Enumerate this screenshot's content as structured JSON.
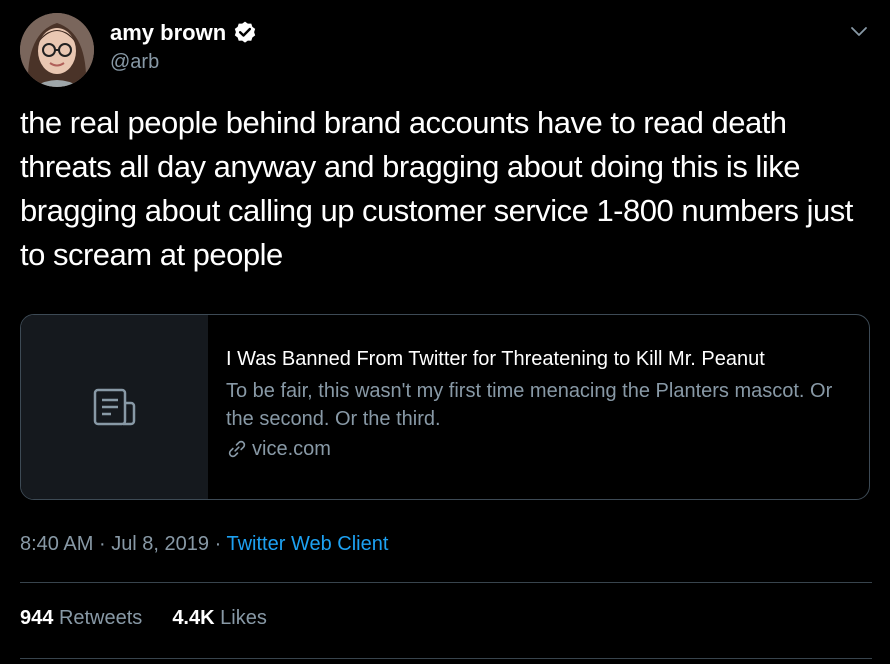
{
  "author": {
    "display_name": "amy brown",
    "handle": "@arb",
    "verified_icon": "verified-badge-icon"
  },
  "tweet": {
    "text": "the real people behind brand accounts have to read death threats all day anyway and bragging about doing this is like bragging about calling up customer service 1-800 numbers just to scream at people"
  },
  "link_card": {
    "title": "I Was Banned From Twitter for Threatening to Kill Mr. Peanut",
    "description": "To be fair, this wasn't my first time menacing the Planters mascot. Or the second. Or the third.",
    "domain": "vice.com",
    "thumbnail_icon": "article-icon"
  },
  "meta": {
    "time": "8:40 AM",
    "separator": "·",
    "date": "Jul 8, 2019",
    "client": "Twitter Web Client"
  },
  "stats": {
    "retweets_count": "944",
    "retweets_label": "Retweets",
    "likes_count": "4.4K",
    "likes_label": "Likes"
  },
  "colors": {
    "background": "#000000",
    "secondary_text": "#8899a6",
    "link": "#1da1f2",
    "border": "#38444d"
  }
}
